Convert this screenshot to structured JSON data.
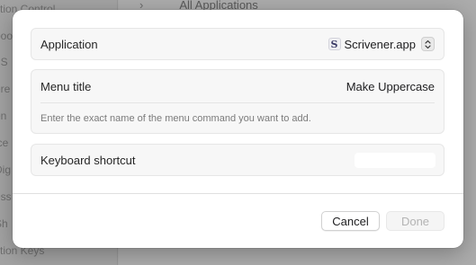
{
  "background": {
    "sidebar_items": [
      "ction Control",
      "boo",
      "t S",
      "ere",
      "en",
      "ice",
      "Dig",
      "ess",
      "Sh",
      "ction Keys"
    ],
    "header_chevron": "›",
    "header_title": "All Applications"
  },
  "dialog": {
    "application": {
      "label": "Application",
      "app_icon_glyph": "S",
      "app_name": "Scrivener.app",
      "popup_arrows": "⌃⌄",
      "icon": "updown-chevron-icon"
    },
    "menu_title": {
      "label": "Menu title",
      "value": "Make Uppercase",
      "hint": "Enter the exact name of the menu command you want to add."
    },
    "keyboard_shortcut": {
      "label": "Keyboard shortcut",
      "value": ""
    },
    "buttons": {
      "cancel": "Cancel",
      "done": "Done"
    }
  }
}
